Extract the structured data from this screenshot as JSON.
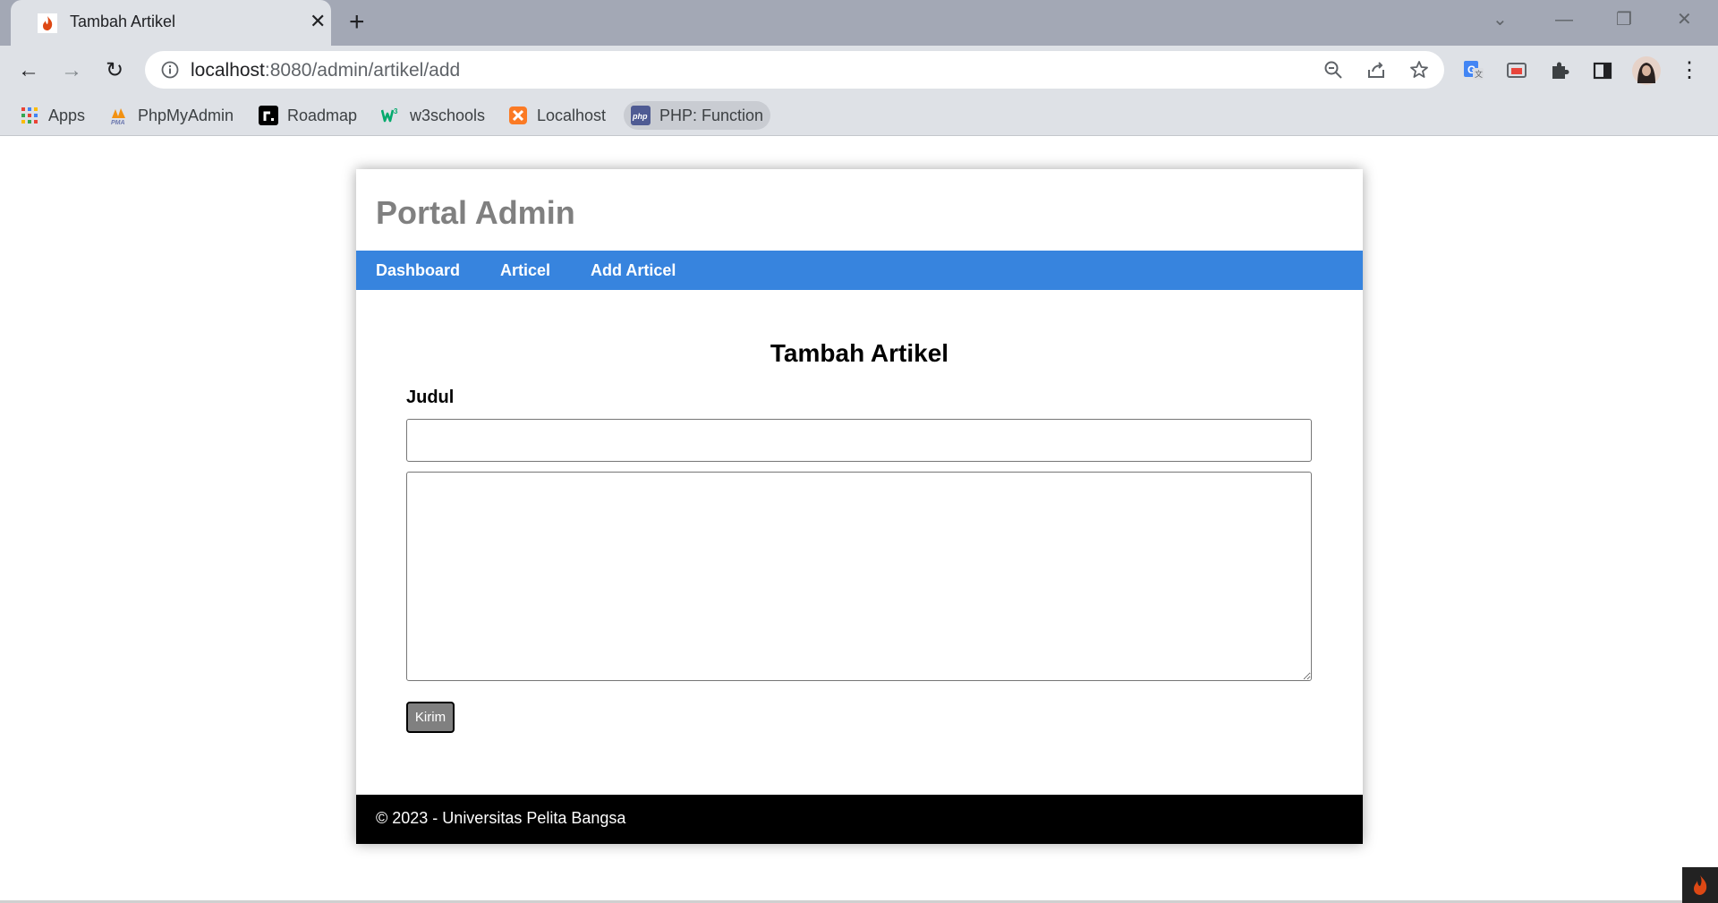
{
  "browser": {
    "tab_title": "Tambah Artikel",
    "url_host": "localhost",
    "url_path": ":8080/admin/artikel/add",
    "bookmarks": [
      {
        "label": "Apps",
        "icon": "apps-grid-icon"
      },
      {
        "label": "PhpMyAdmin",
        "icon": "phpmyadmin-icon"
      },
      {
        "label": "Roadmap",
        "icon": "roadmap-icon"
      },
      {
        "label": "w3schools",
        "icon": "w3schools-icon"
      },
      {
        "label": "Localhost",
        "icon": "xampp-icon"
      },
      {
        "label": "PHP: Function",
        "icon": "php-icon"
      }
    ]
  },
  "page": {
    "brand": "Portal Admin",
    "nav": [
      "Dashboard",
      "Articel",
      "Add Articel"
    ],
    "form": {
      "title": "Tambah Artikel",
      "judul_label": "Judul",
      "judul_value": "",
      "isi_value": "",
      "submit_label": "Kirim"
    },
    "footer": "© 2023 - Universitas Pelita Bangsa"
  },
  "colors": {
    "navbar": "#3784de",
    "footer": "#000000",
    "brand_text": "#808080",
    "button": "#808080"
  }
}
